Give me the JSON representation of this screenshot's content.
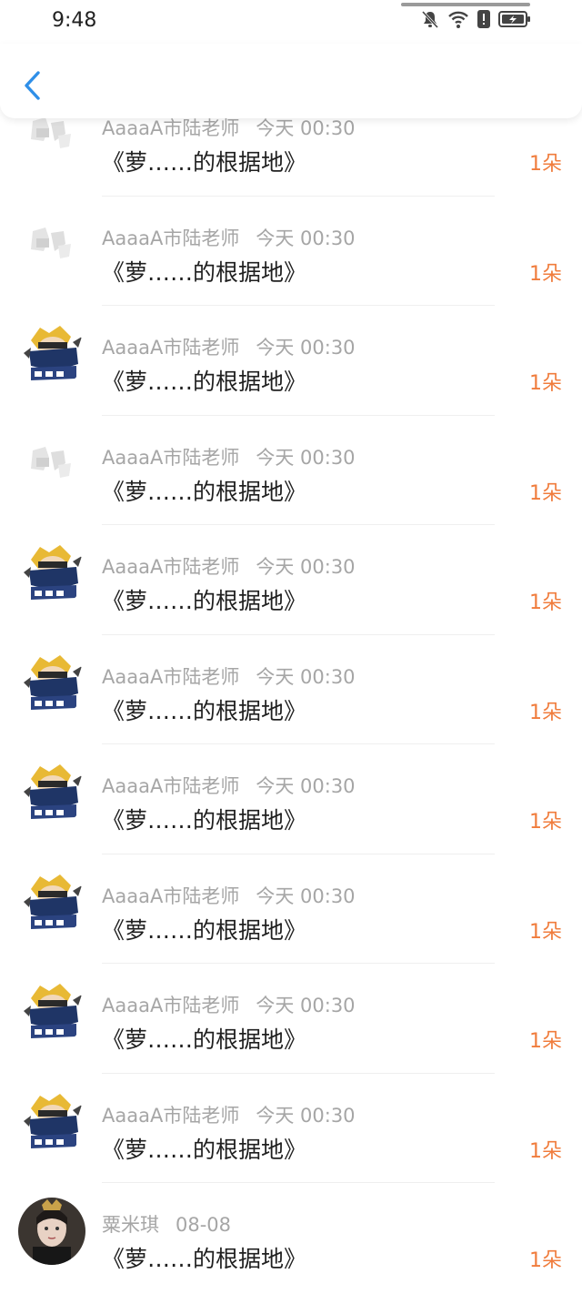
{
  "status_bar": {
    "time": "9:48",
    "icons": [
      "bell-off-icon",
      "wifi-icon",
      "alert-icon",
      "battery-charging-icon"
    ]
  },
  "header": {
    "back_icon": "chevron-left-icon"
  },
  "list": [
    {
      "avatar": "faded-logo",
      "name": "AaaaA市陆老师",
      "time": "今天 00:30",
      "title": "《萝……的根据地》",
      "count": "1朵"
    },
    {
      "avatar": "faded-logo",
      "name": "AaaaA市陆老师",
      "time": "今天 00:30",
      "title": "《萝……的根据地》",
      "count": "1朵"
    },
    {
      "avatar": "anime-character",
      "name": "AaaaA市陆老师",
      "time": "今天 00:30",
      "title": "《萝……的根据地》",
      "count": "1朵"
    },
    {
      "avatar": "faded-logo",
      "name": "AaaaA市陆老师",
      "time": "今天 00:30",
      "title": "《萝……的根据地》",
      "count": "1朵"
    },
    {
      "avatar": "anime-character",
      "name": "AaaaA市陆老师",
      "time": "今天 00:30",
      "title": "《萝……的根据地》",
      "count": "1朵"
    },
    {
      "avatar": "anime-character",
      "name": "AaaaA市陆老师",
      "time": "今天 00:30",
      "title": "《萝……的根据地》",
      "count": "1朵"
    },
    {
      "avatar": "anime-character",
      "name": "AaaaA市陆老师",
      "time": "今天 00:30",
      "title": "《萝……的根据地》",
      "count": "1朵"
    },
    {
      "avatar": "anime-character",
      "name": "AaaaA市陆老师",
      "time": "今天 00:30",
      "title": "《萝……的根据地》",
      "count": "1朵"
    },
    {
      "avatar": "anime-character",
      "name": "AaaaA市陆老师",
      "time": "今天 00:30",
      "title": "《萝……的根据地》",
      "count": "1朵"
    },
    {
      "avatar": "anime-character",
      "name": "AaaaA市陆老师",
      "time": "今天 00:30",
      "title": "《萝……的根据地》",
      "count": "1朵"
    },
    {
      "avatar": "portrait-photo",
      "name": "粟米琪",
      "time": "08-08",
      "title": "《萝……的根据地》",
      "count": "1朵"
    }
  ],
  "colors": {
    "accent": "#2f8fe8",
    "count": "#f07c3c",
    "meta": "#a6a6a6",
    "title": "#1f1f1f"
  }
}
